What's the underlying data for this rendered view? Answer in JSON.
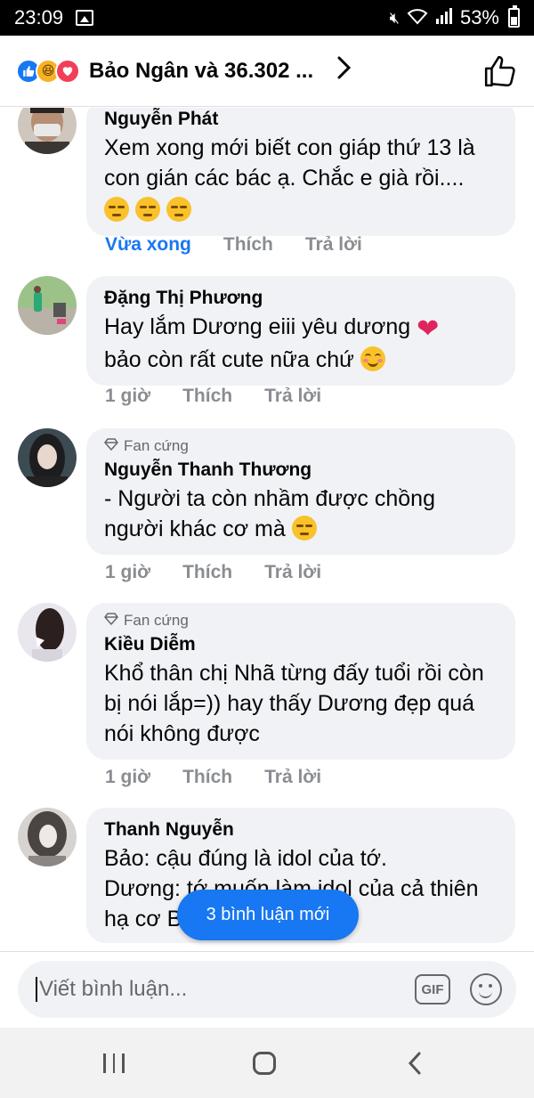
{
  "status_bar": {
    "time": "23:09",
    "battery": "53%"
  },
  "header": {
    "title": "Bảo Ngân và 36.302 ..."
  },
  "comments": [
    {
      "name": "Nguyễn Phát",
      "badge": "",
      "text": "Xem xong mới biết con giáp thứ 13 là con gián các bác ạ. Chắc e già rồi....",
      "time": "Vừa xong",
      "like": "Thích",
      "reply": "Trả lời"
    },
    {
      "name": "Đặng Thị Phương",
      "badge": "",
      "text_line1": "Hay lắm Dương eiii yêu dương",
      "text_line2": "bảo còn rất cute nữa chứ",
      "time": "1 giờ",
      "like": "Thích",
      "reply": "Trả lời"
    },
    {
      "name": "Nguyễn Thanh Thương",
      "badge": "Fan cứng",
      "text": "- Người ta còn nhầm được chồng người khác cơ mà",
      "time": "1 giờ",
      "like": "Thích",
      "reply": "Trả lời"
    },
    {
      "name": "Kiều Diễm",
      "badge": "Fan cứng",
      "text": "Khổ thân chị Nhã từng đấy tuổi rồi còn bị nói lắp=))  hay thấy Dương đẹp quá nói không được",
      "time": "1 giờ",
      "like": "Thích",
      "reply": "Trả lời"
    },
    {
      "name": "Thanh Nguyễn",
      "badge": "",
      "text_line1": "Bảo: cậu đúng là idol của tớ.",
      "text_line2": "Dương: tớ muốn làm idol của cả thiên",
      "text_line3": "hạ cơ B"
    }
  ],
  "new_comments_pill": "3 bình luận mới",
  "composer": {
    "placeholder": "Viết bình luận...",
    "gif_label": "GIF"
  },
  "colors": {
    "accent": "#1877f2",
    "bubble": "#f0f2f5",
    "muted": "#8a8d91"
  },
  "icons": [
    "like-reaction-icon",
    "haha-reaction-icon",
    "love-reaction-icon",
    "chevron-right-icon",
    "thumbs-up-icon",
    "gem-icon",
    "gif-icon",
    "emoji-icon",
    "recents-icon",
    "home-icon",
    "back-icon"
  ]
}
